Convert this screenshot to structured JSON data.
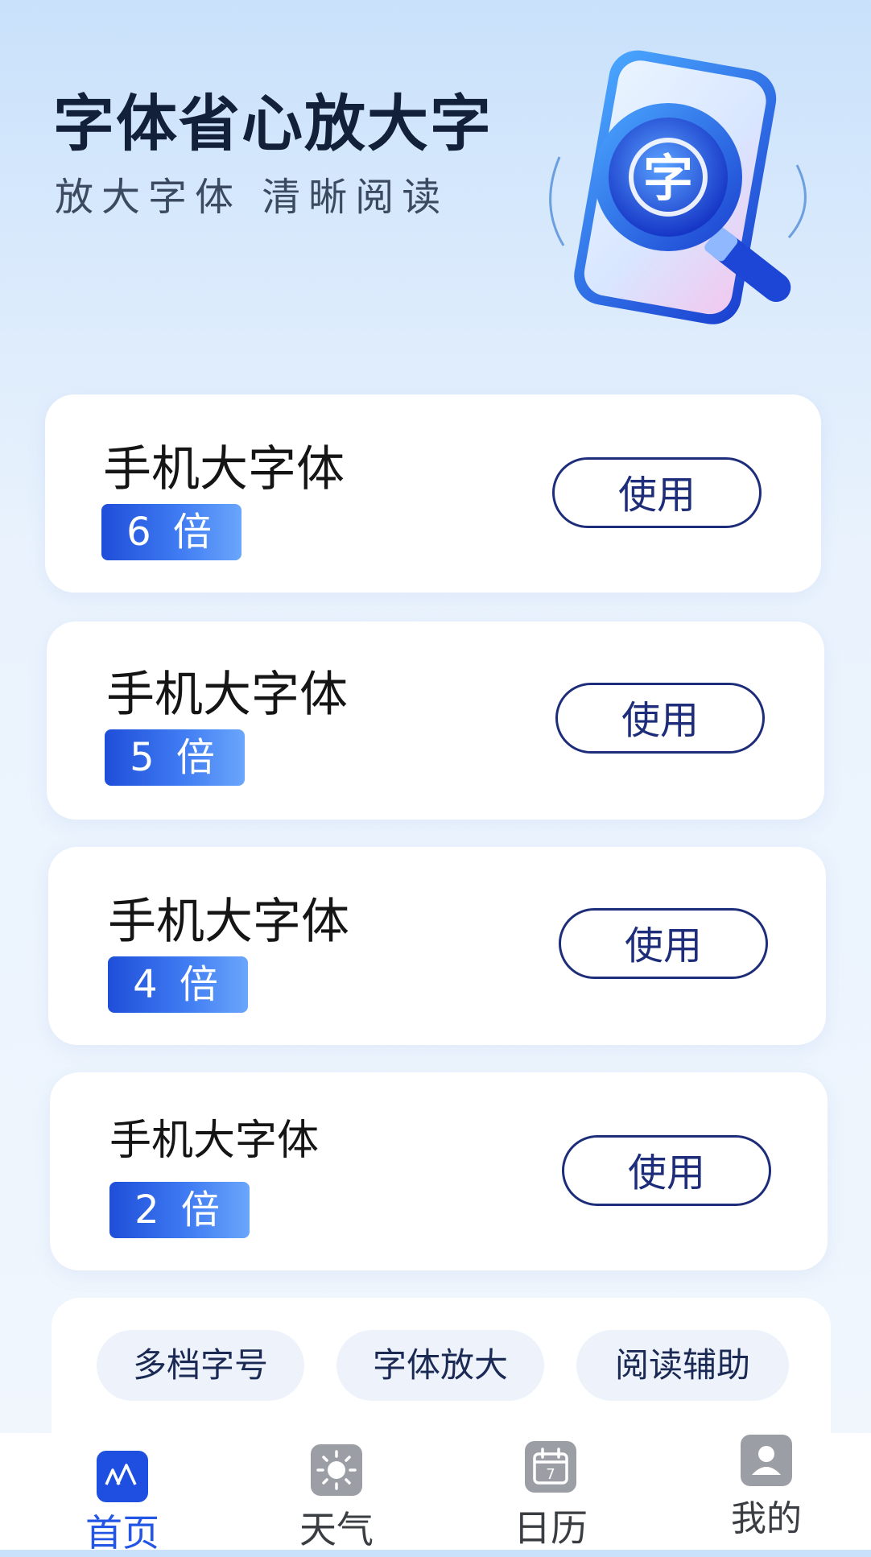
{
  "hero": {
    "title": "字体省心放大字",
    "subtitle": "放大字体  清晰阅读",
    "illustration_icon": "magnifier-character-icon",
    "illustration_char": "字"
  },
  "cards": [
    {
      "title": "手机大字体",
      "badge": "6 倍",
      "button": "使用"
    },
    {
      "title": "手机大字体",
      "badge": "5 倍",
      "button": "使用"
    },
    {
      "title": "手机大字体",
      "badge": "4 倍",
      "button": "使用"
    },
    {
      "title": "手机大字体",
      "badge": "2 倍",
      "button": "使用"
    }
  ],
  "features": [
    "多档字号",
    "字体放大",
    "阅读辅助"
  ],
  "tabs": [
    {
      "label": "首页",
      "icon": "font-size-icon",
      "active": true
    },
    {
      "label": "天气",
      "icon": "sun-icon",
      "active": false
    },
    {
      "label": "日历",
      "icon": "calendar-icon",
      "active": false,
      "icon_text": "7"
    },
    {
      "label": "我的",
      "icon": "user-icon",
      "active": false
    }
  ],
  "colors": {
    "accent": "#1d2d7a",
    "badge_gradient_start": "#1f4ed9",
    "tab_active": "#2456e6",
    "tab_inactive": "#8a8d93"
  }
}
